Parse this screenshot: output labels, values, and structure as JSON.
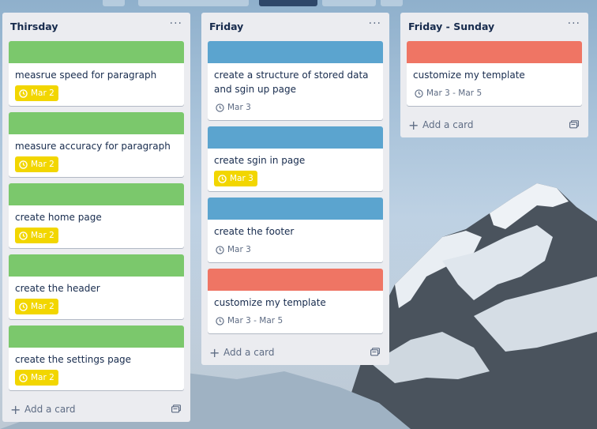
{
  "lists": [
    {
      "title": "Thirsday",
      "menu": "···",
      "cards": [
        {
          "cover_color": "#7bc86c",
          "title": "measrue speed for paragraph",
          "date": "Mar 2",
          "date_style": "due"
        },
        {
          "cover_color": "#7bc86c",
          "title": "measure accuracy for paragraph",
          "date": "Mar 2",
          "date_style": "due"
        },
        {
          "cover_color": "#7bc86c",
          "title": "create home page",
          "date": "Mar 2",
          "date_style": "due"
        },
        {
          "cover_color": "#7bc86c",
          "title": "create the header",
          "date": "Mar 2",
          "date_style": "due"
        },
        {
          "cover_color": "#7bc86c",
          "title": "create the settings page",
          "date": "Mar 2",
          "date_style": "due"
        }
      ],
      "add_card_label": "Add a card"
    },
    {
      "title": "Friday",
      "menu": "···",
      "cards": [
        {
          "cover_color": "#5ba4cf",
          "title": "create a structure of stored data and sgin up page",
          "date": "Mar 3",
          "date_style": "plain"
        },
        {
          "cover_color": "#5ba4cf",
          "title": "create sgin in page",
          "date": "Mar 3",
          "date_style": "due"
        },
        {
          "cover_color": "#5ba4cf",
          "title": "create the footer",
          "date": "Mar 3",
          "date_style": "plain"
        },
        {
          "cover_color": "#ef7564",
          "title": "customize my template",
          "date": "Mar 3 - Mar 5",
          "date_style": "plain"
        }
      ],
      "add_card_label": "Add a card"
    },
    {
      "title": "Friday - Sunday",
      "menu": "···",
      "cards": [
        {
          "cover_color": "#ef7564",
          "title": "customize my template",
          "date": "Mar 3 - Mar 5",
          "date_style": "plain"
        }
      ],
      "add_card_label": "Add a card"
    }
  ],
  "icons": {
    "date": "clock-icon",
    "add": "plus-icon",
    "template": "card-template-icon"
  }
}
